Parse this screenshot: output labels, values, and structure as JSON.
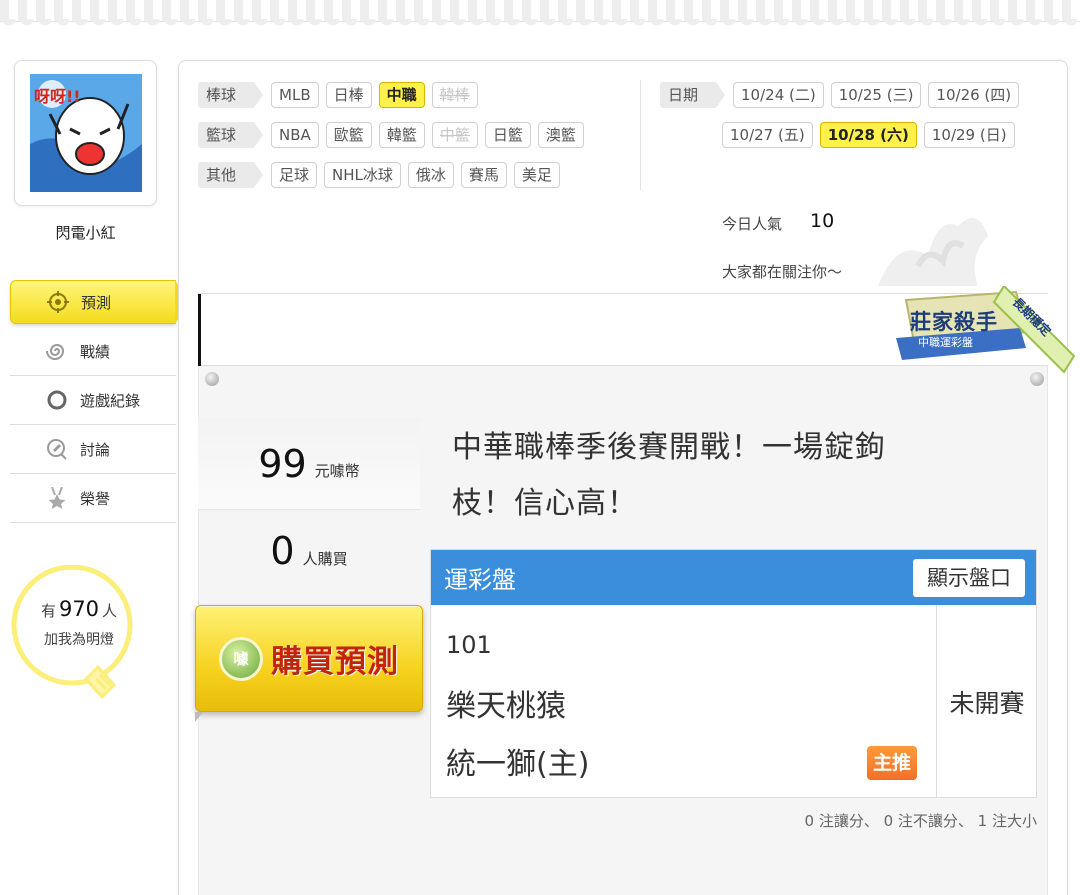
{
  "profile": {
    "username": "閃電小紅",
    "avatar_caption": "呀呀!!",
    "fans_prefix": "有",
    "fans_count": "970",
    "fans_unit": "人",
    "fans_suffix": "加我為明燈"
  },
  "sidebar": {
    "items": [
      {
        "label": "預測",
        "icon": "target-icon",
        "active": true
      },
      {
        "label": "戰績",
        "icon": "spiral-icon",
        "active": false
      },
      {
        "label": "遊戲紀錄",
        "icon": "ring-icon",
        "active": false
      },
      {
        "label": "討論",
        "icon": "discussion-icon",
        "active": false
      },
      {
        "label": "榮譽",
        "icon": "medal-icon",
        "active": false
      }
    ]
  },
  "filters": {
    "baseball": {
      "label": "棒球",
      "tags": [
        {
          "text": "MLB",
          "state": "normal"
        },
        {
          "text": "日棒",
          "state": "normal"
        },
        {
          "text": "中職",
          "state": "active"
        },
        {
          "text": "韓棒",
          "state": "disabled"
        }
      ]
    },
    "basketball": {
      "label": "籃球",
      "tags": [
        {
          "text": "NBA",
          "state": "normal"
        },
        {
          "text": "歐籃",
          "state": "normal"
        },
        {
          "text": "韓籃",
          "state": "normal"
        },
        {
          "text": "中籃",
          "state": "disabled"
        },
        {
          "text": "日籃",
          "state": "normal"
        },
        {
          "text": "澳籃",
          "state": "normal"
        }
      ]
    },
    "other": {
      "label": "其他",
      "tags": [
        {
          "text": "足球",
          "state": "normal"
        },
        {
          "text": "NHL冰球",
          "state": "normal"
        },
        {
          "text": "俄冰",
          "state": "normal"
        },
        {
          "text": "賽馬",
          "state": "normal"
        },
        {
          "text": "美足",
          "state": "normal"
        }
      ]
    }
  },
  "dates": {
    "label": "日期",
    "row1": [
      {
        "text": "10/24 (二)",
        "state": "normal"
      },
      {
        "text": "10/25 (三)",
        "state": "normal"
      },
      {
        "text": "10/26 (四)",
        "state": "normal"
      }
    ],
    "row2": [
      {
        "text": "10/27 (五)",
        "state": "normal"
      },
      {
        "text": "10/28 (六)",
        "state": "active"
      },
      {
        "text": "10/29 (日)",
        "state": "normal"
      }
    ]
  },
  "popularity": {
    "label": "今日人氣",
    "value": "10",
    "subtitle": "大家都在關注你～"
  },
  "badge": {
    "title": "莊家殺手",
    "subtitle": "中職運彩盤",
    "corner": "長期穩定"
  },
  "prediction": {
    "coin_amount": "99",
    "coin_unit": "元噱幣",
    "buyer_count": "0",
    "buyer_unit": "人購買",
    "buy_label": "購買預測",
    "buy_coin_glyph": "噱",
    "headline_line1": "中華職棒季後賽開戰！一場錠鉤",
    "headline_line2": "枝！信心高！"
  },
  "odds": {
    "title": "運彩盤",
    "show_button": "顯示盤口",
    "game_number": "101",
    "away_team": "樂天桃猿",
    "home_team": "統一獅(主)",
    "main_pick_badge": "主推",
    "status": "未開賽"
  },
  "stats_line": "0 注讓分、 0 注不讓分、 1 注大小",
  "colors": {
    "accent_yellow": "#f4dc1c",
    "odds_blue": "#3b8edb",
    "badge_orange": "#f0702a",
    "buy_red": "#c0260e"
  }
}
